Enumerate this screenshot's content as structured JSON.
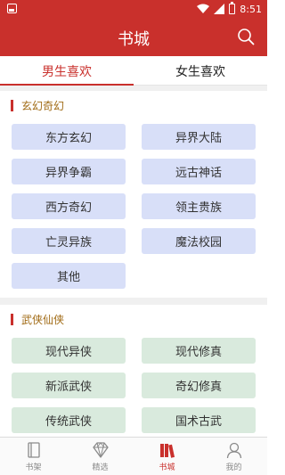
{
  "status_bar": {
    "time": "8:51",
    "battery_label": ""
  },
  "app_bar": {
    "title": "书城"
  },
  "tabs": [
    {
      "label": "男生喜欢",
      "active": true
    },
    {
      "label": "女生喜欢",
      "active": false
    }
  ],
  "sections": [
    {
      "title": "玄幻奇幻",
      "color": "#d8dff8",
      "items": [
        "东方玄幻",
        "异界大陆",
        "异界争霸",
        "远古神话",
        "西方奇幻",
        "领主贵族",
        "亡灵异族",
        "魔法校园",
        "其他"
      ]
    },
    {
      "title": "武侠仙侠",
      "color": "#d9eadd",
      "items": [
        "现代异侠",
        "现代修真",
        "新派武侠",
        "奇幻修真",
        "传统武侠",
        "国术古武"
      ]
    }
  ],
  "bottom_nav": [
    {
      "label": "书架",
      "icon": "book-icon",
      "active": false
    },
    {
      "label": "精选",
      "icon": "diamond-icon",
      "active": false
    },
    {
      "label": "书城",
      "icon": "bookstore-icon",
      "active": true
    },
    {
      "label": "我的",
      "icon": "person-icon",
      "active": false
    }
  ],
  "colors": {
    "primary": "#c9302c",
    "section_title": "#a06a14",
    "blue_chip": "#d8dff8",
    "green_chip": "#d9eadd"
  }
}
